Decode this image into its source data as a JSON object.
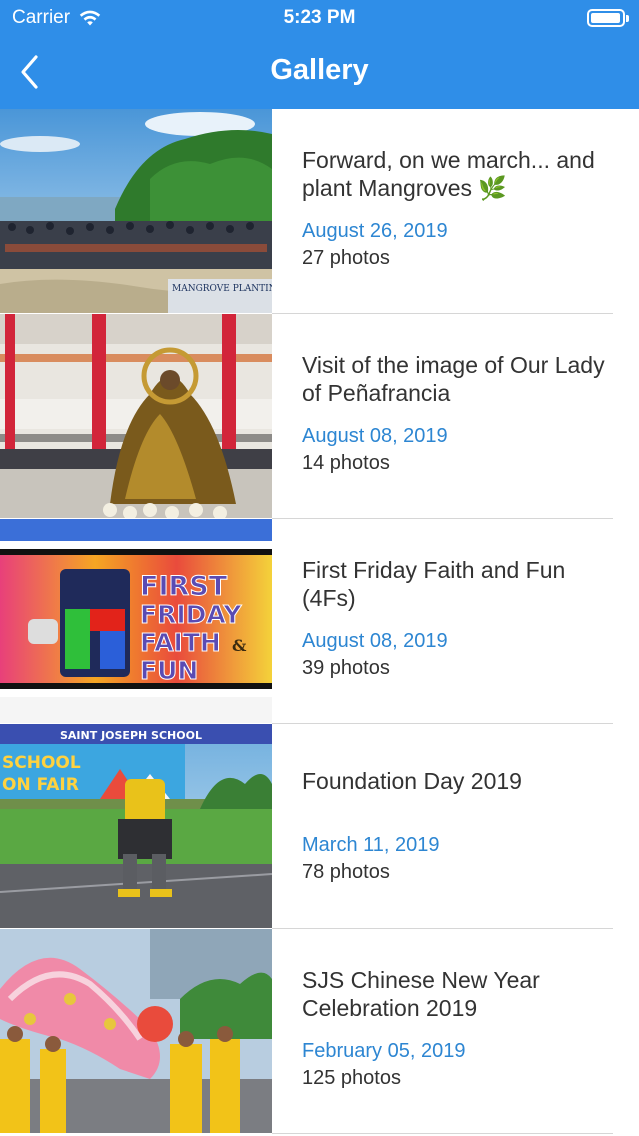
{
  "status_bar": {
    "carrier": "Carrier",
    "time": "5:23 PM"
  },
  "nav": {
    "title": "Gallery",
    "back_icon": "chevron-left-icon"
  },
  "theme": {
    "header_color": "#2f8ee8",
    "date_color": "#2d86d2"
  },
  "albums": [
    {
      "title": "Forward, on we march... and plant Mangroves 🌿",
      "date": "August 26, 2019",
      "count": "27 photos",
      "thumb_caption": "MANGROVE PLANTING"
    },
    {
      "title": "Visit of the image of Our Lady of Peñafrancia",
      "date": "August 08, 2019",
      "count": "14 photos"
    },
    {
      "title": "First Friday Faith and Fun (4Fs)",
      "date": "August 08, 2019",
      "count": "39 photos",
      "thumb_text": [
        "FIRST",
        "FRIDAY",
        "FAITH",
        "FUN",
        "&"
      ]
    },
    {
      "title": "Foundation Day 2019",
      "date": "March 11, 2019",
      "count": "78 photos",
      "thumb_banner": "SAINT JOSEPH SCHOOL",
      "thumb_sign": [
        "SCHOOL",
        "ON FAIR"
      ]
    },
    {
      "title": "SJS Chinese New Year Celebration 2019",
      "date": "February 05, 2019",
      "count": "125 photos"
    }
  ]
}
